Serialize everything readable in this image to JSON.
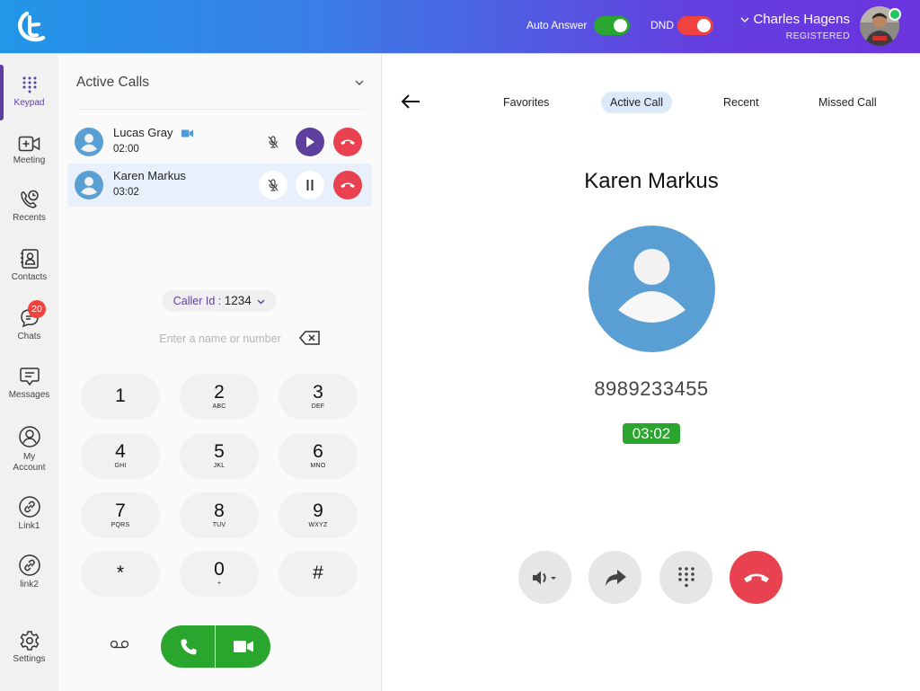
{
  "header": {
    "logo": "t-logo",
    "auto_answer": {
      "label": "Auto Answer",
      "state": "on",
      "color": "#2aa52e"
    },
    "dnd": {
      "label": "DND",
      "state": "on",
      "color": "#f0433d"
    },
    "user": {
      "name": "Charles Hagens",
      "status": "REGISTERED",
      "presence": "online",
      "presence_color": "#22c55e"
    }
  },
  "sidebar": {
    "items": [
      {
        "label": "Keypad",
        "icon": "keypad-icon",
        "active": true
      },
      {
        "label": "Meeting",
        "icon": "video-plus-icon"
      },
      {
        "label": "Recents",
        "icon": "phone-clock-icon"
      },
      {
        "label": "Contacts",
        "icon": "contact-book-icon"
      },
      {
        "label": "Chats",
        "icon": "chat-bubbles-icon",
        "badge": "20"
      },
      {
        "label": "Messages",
        "icon": "message-icon"
      },
      {
        "label": "My",
        "label2": "Account",
        "icon": "user-circle-icon"
      },
      {
        "label": "Link1",
        "icon": "link-icon"
      },
      {
        "label": "link2",
        "icon": "link-icon"
      },
      {
        "label": "Settings",
        "icon": "gear-icon"
      }
    ]
  },
  "active_calls": {
    "title": "Active Calls",
    "calls": [
      {
        "name": "Lucas Gray",
        "time": "02:00",
        "video": true,
        "muted": true,
        "state": "on-hold",
        "action": "resume"
      },
      {
        "name": "Karen Markus",
        "time": "03:02",
        "video": false,
        "muted": true,
        "state": "active",
        "action": "hold",
        "selected": true
      }
    ]
  },
  "dialer": {
    "caller_id_label": "Caller Id :",
    "caller_id_value": "1234",
    "input_value": "",
    "input_placeholder": "Enter a name or number",
    "keys": [
      {
        "digit": "1",
        "letters": ""
      },
      {
        "digit": "2",
        "letters": "ABC"
      },
      {
        "digit": "3",
        "letters": "DEF"
      },
      {
        "digit": "4",
        "letters": "GHI"
      },
      {
        "digit": "5",
        "letters": "JKL"
      },
      {
        "digit": "6",
        "letters": "MNO"
      },
      {
        "digit": "7",
        "letters": "PQRS"
      },
      {
        "digit": "8",
        "letters": "TUV"
      },
      {
        "digit": "9",
        "letters": "WXYZ"
      },
      {
        "digit": "*",
        "letters": ""
      },
      {
        "digit": "0",
        "letters": "+"
      },
      {
        "digit": "#",
        "letters": ""
      }
    ]
  },
  "right": {
    "tabs": [
      {
        "label": "Favorites"
      },
      {
        "label": "Active Call",
        "active": true
      },
      {
        "label": "Recent"
      },
      {
        "label": "Missed Call"
      }
    ],
    "caller_name": "Karen Markus",
    "caller_number": "8989233455",
    "timer": "03:02",
    "controls": [
      "speaker-icon",
      "forward-icon",
      "dialpad-icon",
      "hangup-icon"
    ]
  },
  "colors": {
    "accent": "#5b3fa2",
    "green": "#2aa52e",
    "red": "#e8414f",
    "avatar_blue": "#5a9fd4"
  }
}
